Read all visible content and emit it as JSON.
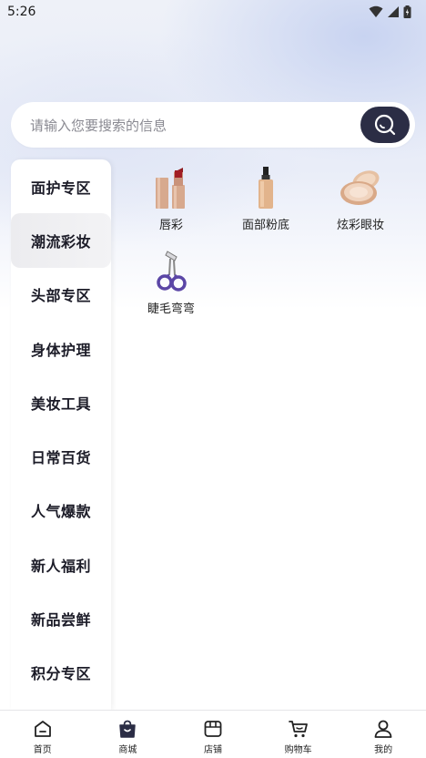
{
  "status_bar": {
    "time": "5:26"
  },
  "search": {
    "placeholder": "请输入您要搜索的信息"
  },
  "sidebar": {
    "items": [
      {
        "label": "面护专区"
      },
      {
        "label": "潮流彩妆",
        "active": true
      },
      {
        "label": "头部专区"
      },
      {
        "label": "身体护理"
      },
      {
        "label": "美妆工具"
      },
      {
        "label": "日常百货"
      },
      {
        "label": "人气爆款"
      },
      {
        "label": "新人福利"
      },
      {
        "label": "新品尝鲜"
      },
      {
        "label": "积分专区"
      }
    ]
  },
  "products": [
    {
      "label": "唇彩",
      "icon": "lipstick-icon"
    },
    {
      "label": "面部粉底",
      "icon": "foundation-bottle-icon"
    },
    {
      "label": "炫彩眼妆",
      "icon": "compact-powder-icon"
    },
    {
      "label": "睫毛弯弯",
      "icon": "eyelash-curler-icon"
    }
  ],
  "bottom_nav": {
    "items": [
      {
        "label": "首页",
        "icon": "home-icon"
      },
      {
        "label": "商城",
        "icon": "shopping-bag-icon",
        "active": true
      },
      {
        "label": "店铺",
        "icon": "store-icon"
      },
      {
        "label": "购物车",
        "icon": "cart-icon"
      },
      {
        "label": "我的",
        "icon": "profile-icon"
      }
    ]
  },
  "colors": {
    "accent_dark": "#2b2d45",
    "sidebar_active_bg": "#ececef",
    "background_top": "#e9edf8"
  }
}
